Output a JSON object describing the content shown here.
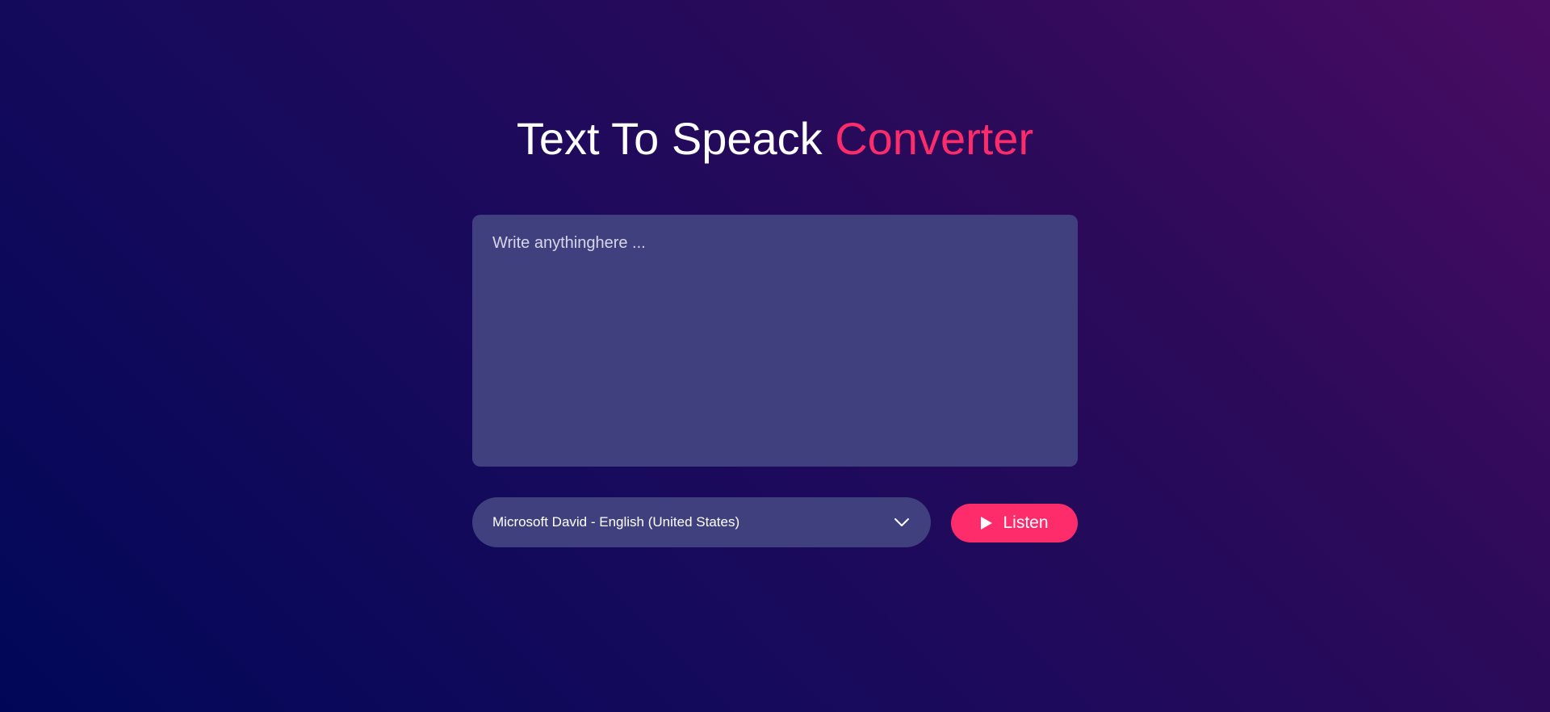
{
  "header": {
    "title_main": "Text To Speack",
    "title_accent": "Converter"
  },
  "editor": {
    "placeholder": "Write anythinghere ...",
    "value": ""
  },
  "voice_select": {
    "selected": "Microsoft David - English (United States)",
    "icon": "chevron-down-icon"
  },
  "listen_button": {
    "label": "Listen",
    "icon": "play-icon"
  },
  "colors": {
    "accent": "#ff2c6c",
    "panel": "#41407f",
    "background_start": "#010758",
    "background_end": "#490c63"
  }
}
